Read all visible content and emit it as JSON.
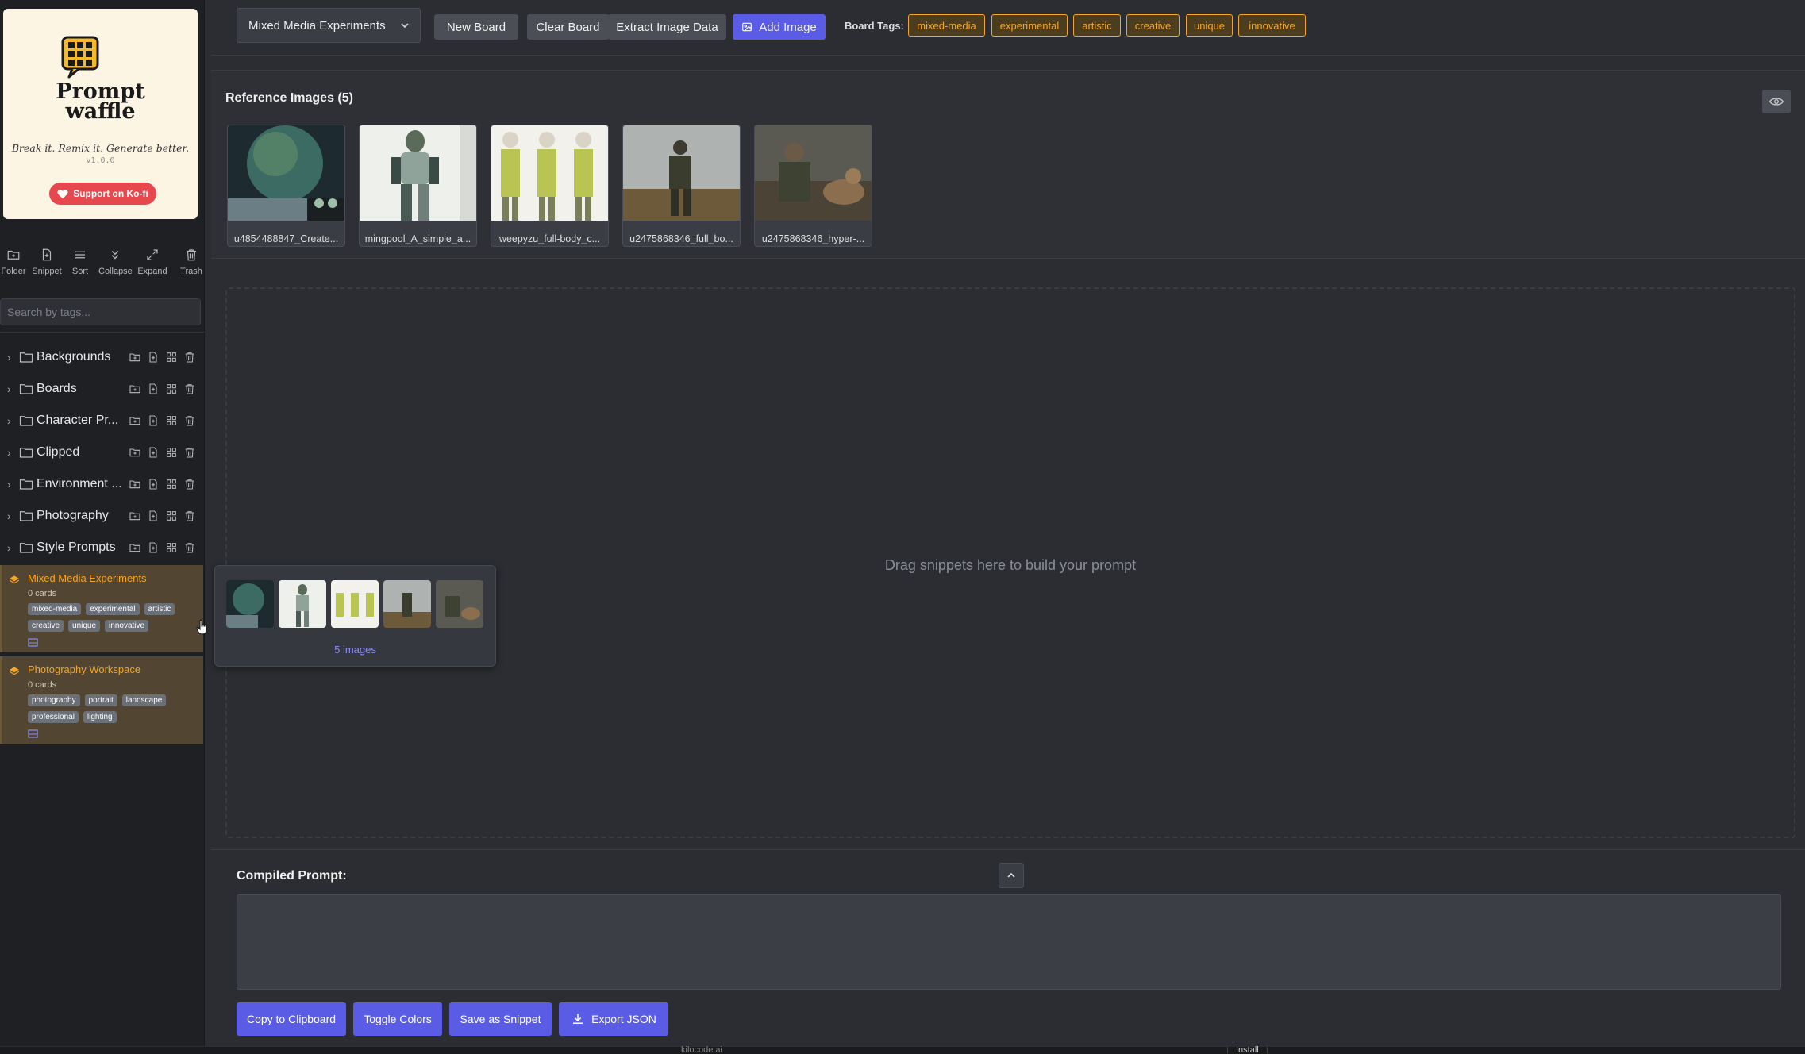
{
  "sidebar": {
    "logo": {
      "line1": "Prompt",
      "line2": "waffle",
      "tagline": "Break it. Remix it. Generate better.",
      "version": "v1.0.0",
      "support_label": "Support on Ko-fi"
    },
    "toolbar": [
      {
        "label": "Folder",
        "icon": "folder-add-icon"
      },
      {
        "label": "Snippet",
        "icon": "file-add-icon"
      },
      {
        "label": "Sort",
        "icon": "sort-lines-icon"
      },
      {
        "label": "Collapse",
        "icon": "collapse-chevrons-icon"
      },
      {
        "label": "Expand",
        "icon": "expand-arrows-icon"
      },
      {
        "label": "Trash",
        "icon": "trash-icon"
      }
    ],
    "search_placeholder": "Search by tags...",
    "folders": [
      {
        "name": "Backgrounds"
      },
      {
        "name": "Boards"
      },
      {
        "name": "Character Pr..."
      },
      {
        "name": "Clipped"
      },
      {
        "name": "Environment ..."
      },
      {
        "name": "Photography"
      },
      {
        "name": "Style Prompts"
      }
    ],
    "boards": [
      {
        "title": "Mixed Media Experiments",
        "count": "0 cards",
        "tags": [
          "mixed-media",
          "experimental",
          "artistic",
          "creative",
          "unique",
          "innovative"
        ],
        "active": true
      },
      {
        "title": "Photography Workspace",
        "count": "0 cards",
        "tags": [
          "photography",
          "portrait",
          "landscape",
          "professional",
          "lighting"
        ],
        "active": false
      }
    ]
  },
  "topbar": {
    "board_select": "Mixed Media Experiments",
    "buttons": {
      "new_board": "New Board",
      "clear_board": "Clear Board",
      "extract": "Extract Image Data",
      "add_image": "Add Image"
    },
    "board_tags_label": "Board Tags:",
    "board_tags": [
      "mixed-media",
      "experimental",
      "artistic",
      "creative",
      "unique",
      "innovative"
    ]
  },
  "refs": {
    "title": "Reference Images (5)",
    "images": [
      {
        "caption": "u4854488847_Create..."
      },
      {
        "caption": "mingpool_A_simple_a..."
      },
      {
        "caption": "weepyzu_full-body_c..."
      },
      {
        "caption": "u2475868346_full_bo..."
      },
      {
        "caption": "u2475868346_hyper-..."
      }
    ]
  },
  "dropzone": {
    "text": "Drag snippets here to build your prompt"
  },
  "hover_preview": {
    "count": "5 images"
  },
  "compiled": {
    "label": "Compiled Prompt:",
    "value": "",
    "buttons": {
      "copy": "Copy to Clipboard",
      "toggle": "Toggle Colors",
      "save": "Save as Snippet",
      "export": "Export JSON"
    }
  },
  "statusbar": {
    "mid": "kilocode.ai",
    "right": "Install"
  },
  "colors": {
    "accent": "#5b5ce6",
    "tag_orange": "#f5a623",
    "board_bg": "#524633",
    "logo_bg": "#fdf5e4",
    "kofi": "#e5484d"
  }
}
